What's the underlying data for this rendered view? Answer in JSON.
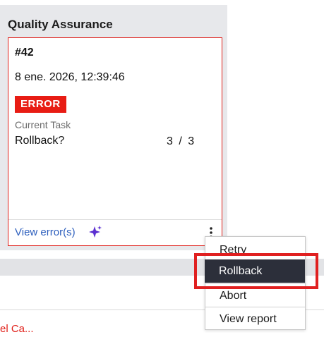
{
  "lane": {
    "title": "Quality Assurance"
  },
  "card": {
    "case_id": "#42",
    "timestamp": "8 ene. 2026, 12:39:46",
    "status_badge": "ERROR",
    "current_task_label": "Current Task",
    "current_task": "Rollback?",
    "step_counter": "3 / 3",
    "view_errors_label": "View error(s)",
    "icons": {
      "sparkle": "sparkle-icon",
      "more": "kebab-menu-icon"
    }
  },
  "menu": {
    "items": [
      {
        "label": "Retry"
      },
      {
        "label": "Rollback",
        "highlighted": true
      },
      {
        "label": "Abort"
      },
      {
        "label": "View report"
      }
    ]
  },
  "background": {
    "truncated_link": "el Ca..."
  },
  "colors": {
    "error": "#e81c14",
    "link": "#2c5ebd",
    "sparkle": "#5b2fd0",
    "menu_highlight": "#2c2f3a",
    "annotation_box": "#e02020"
  }
}
